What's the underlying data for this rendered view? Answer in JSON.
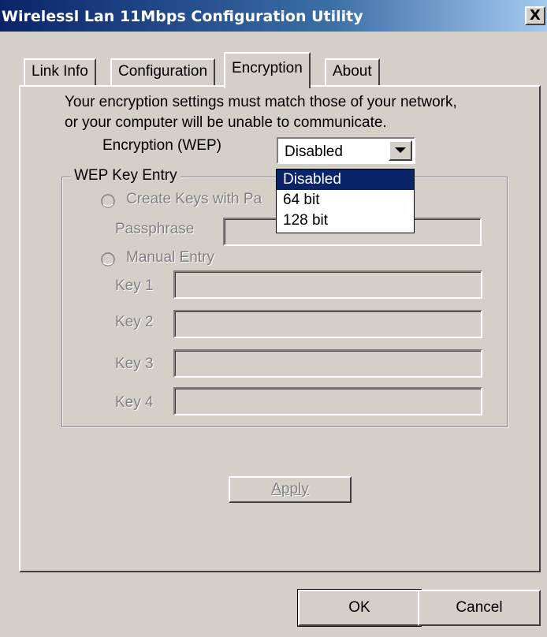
{
  "window": {
    "title": "Wirelessl Lan 11Mbps Configuration Utility",
    "close_glyph": "X"
  },
  "tabs": [
    {
      "label": "Link Info"
    },
    {
      "label": "Configuration"
    },
    {
      "label": "Encryption",
      "active": true
    },
    {
      "label": "About"
    }
  ],
  "encryption": {
    "description_line1": "Your encryption settings must match those of your network,",
    "description_line2": "or your computer will be unable to communicate.",
    "wep_label": "Encryption (WEP)",
    "wep_selected": "Disabled",
    "wep_options": [
      "Disabled",
      "64 bit",
      "128 bit"
    ]
  },
  "wep_key_entry": {
    "legend": "WEP Key Entry",
    "create_keys_label": "Create Keys with Pa",
    "create_keys_underline": "P",
    "passphrase_label": "Passphrase",
    "manual_entry_label": "Manual Entry",
    "keys": [
      {
        "label": "Key 1",
        "value": ""
      },
      {
        "label": "Key 2",
        "value": ""
      },
      {
        "label": "Key 3",
        "value": ""
      },
      {
        "label": "Key 4",
        "value": ""
      }
    ]
  },
  "buttons": {
    "apply": "Apply",
    "ok": "OK",
    "cancel": "Cancel"
  },
  "icons": {
    "close": "close-icon",
    "dropdown": "chevron-down-icon",
    "radio": "radio-icon"
  },
  "colors": {
    "face": "#d4d0c8",
    "title_start": "#0a246a",
    "title_end": "#a6caf0",
    "selection": "#0a246a",
    "disabled_text": "#808080"
  }
}
